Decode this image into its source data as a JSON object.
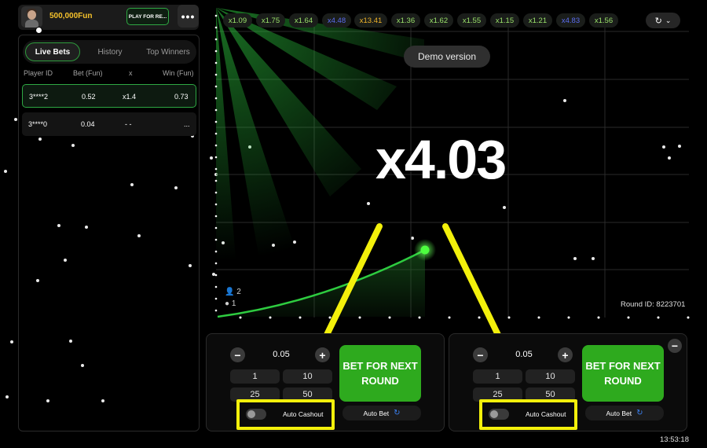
{
  "header": {
    "balance": "500,000Fun",
    "play_real_label": "PLAY FOR RE...",
    "more_label": "•••"
  },
  "left_panel": {
    "tabs": [
      {
        "label": "Live Bets",
        "active": true
      },
      {
        "label": "History",
        "active": false
      },
      {
        "label": "Top Winners",
        "active": false
      }
    ],
    "columns": [
      "Player ID",
      "Bet (Fun)",
      "x",
      "Win (Fun)"
    ],
    "rows": [
      {
        "player": "3****2",
        "bet": "0.52",
        "x": "x1.4",
        "win": "0.73",
        "won": true
      },
      {
        "player": "3****0",
        "bet": "0.04",
        "x": "- -",
        "win": "...",
        "won": false
      }
    ]
  },
  "multipliers": [
    {
      "value": "x1.09",
      "color": "#9be36b"
    },
    {
      "value": "x1.75",
      "color": "#9be36b"
    },
    {
      "value": "x1.64",
      "color": "#9be36b"
    },
    {
      "value": "x4.48",
      "color": "#5b6cf0"
    },
    {
      "value": "x13.41",
      "color": "#f0b429"
    },
    {
      "value": "x1.36",
      "color": "#9be36b"
    },
    {
      "value": "x1.62",
      "color": "#9be36b"
    },
    {
      "value": "x1.55",
      "color": "#9be36b"
    },
    {
      "value": "x1.15",
      "color": "#9be36b"
    },
    {
      "value": "x1.21",
      "color": "#9be36b"
    },
    {
      "value": "x4.83",
      "color": "#5b6cf0"
    },
    {
      "value": "x1.56",
      "color": "#9be36b"
    }
  ],
  "game": {
    "demo_label": "Demo version",
    "current_multiplier": "x4.03",
    "players_count": "2",
    "bets_count": "1",
    "round_id": "Round ID:  8223701",
    "accent": "#2ecc40"
  },
  "bet_panels": [
    {
      "amount": "0.05",
      "quick": [
        "1",
        "10",
        "25",
        "50"
      ],
      "bet_label": "BET FOR NEXT ROUND",
      "auto_cashout_label": "Auto Cashout",
      "auto_bet_label": "Auto Bet"
    },
    {
      "amount": "0.05",
      "quick": [
        "1",
        "10",
        "25",
        "50"
      ],
      "bet_label": "BET FOR NEXT ROUND",
      "auto_cashout_label": "Auto Cashout",
      "auto_bet_label": "Auto Bet"
    }
  ],
  "clock": "13:53:18"
}
